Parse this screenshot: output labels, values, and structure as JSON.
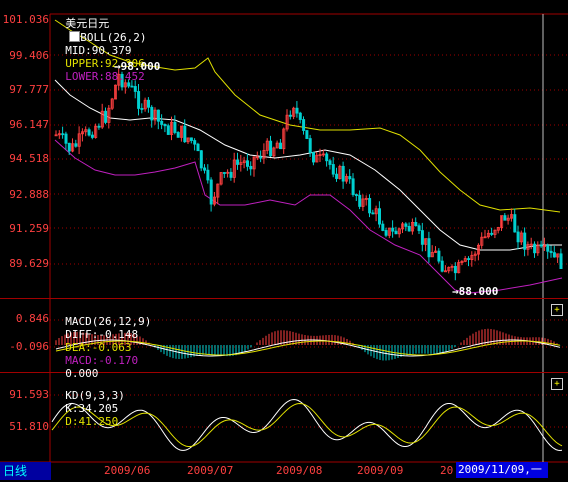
{
  "header": {
    "symbol": "美元日元",
    "indicator": "BOLL(26,2)",
    "mid": "MID:90.379",
    "upper": "UPPER:92.306",
    "lower": "LOWER:88.452"
  },
  "price_axis": [
    "101.036",
    "99.406",
    "97.777",
    "96.147",
    "94.518",
    "92.888",
    "91.259",
    "89.629"
  ],
  "price_annotations": {
    "high": "98.000",
    "low": "88.000"
  },
  "macd_panel": {
    "title": "MACD(26,12,9)",
    "diff": "DIFF:-0.148",
    "dea": "DEA:-0.063",
    "macd": "MACD:-0.170",
    "extra": "0.000",
    "axis": [
      "0.846",
      "-0.096"
    ]
  },
  "kd_panel": {
    "title": "KD(9,3,3)",
    "k": "K:34.205",
    "d": "D:41.250",
    "axis": [
      "91.593",
      "51.810"
    ]
  },
  "x_axis": [
    "2009/06",
    "2009/07",
    "2009/08",
    "2009/09",
    "20"
  ],
  "period_label": "日线",
  "cursor_date": "2009/11/09,一",
  "expand_icon": "+",
  "colors": {
    "up": "#ff4040",
    "down": "#00d0d0",
    "upper_band": "#e0e000",
    "lower_band": "#c020c0",
    "mid_band": "#ffffff",
    "grid": "#a00000"
  }
}
